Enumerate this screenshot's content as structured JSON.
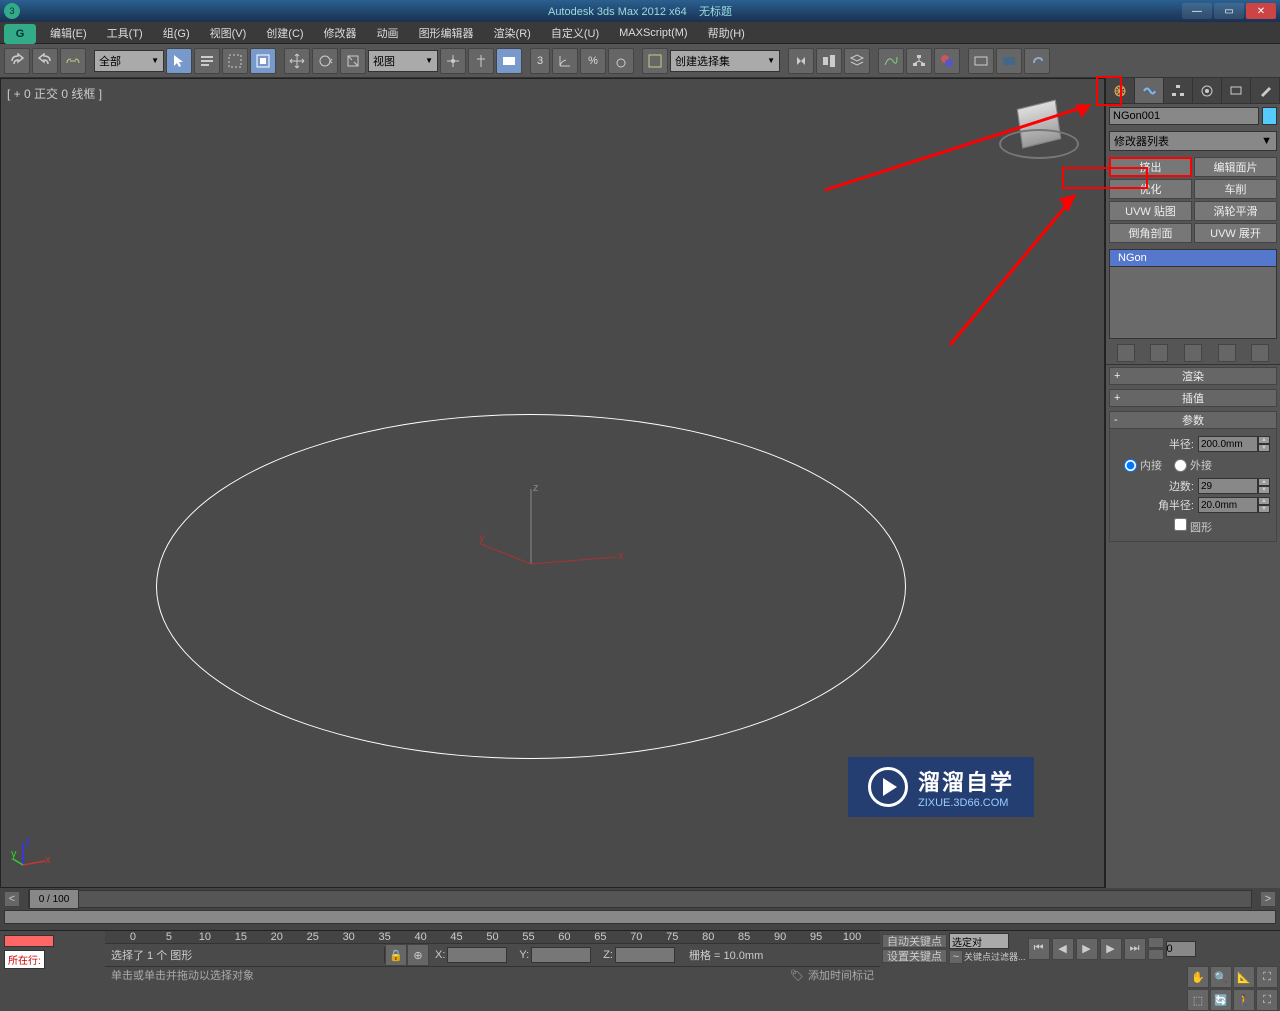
{
  "title": {
    "app": "Autodesk 3ds Max  2012 x64",
    "doc": "无标题"
  },
  "menu": [
    "编辑(E)",
    "工具(T)",
    "组(G)",
    "视图(V)",
    "创建(C)",
    "修改器",
    "动画",
    "图形编辑器",
    "渲染(R)",
    "自定义(U)",
    "MAXScript(M)",
    "帮助(H)"
  ],
  "toolbar": {
    "filter": "全部",
    "refcoord": "视图",
    "named_sel": "创建选择集"
  },
  "viewport": {
    "label": "[ + 0 正交 0 线框  ]"
  },
  "cmdpanel": {
    "obj_name": "NGon001",
    "modlist_label": "修改器列表",
    "buttons": {
      "extrude": "挤出",
      "edit_patch": "编辑面片",
      "optimize": "优化",
      "lathe": "车削",
      "uvw_map": "UVW 贴图",
      "turbosmooth": "涡轮平滑",
      "bevel_profile": "倒角剖面",
      "uvw_unwrap": "UVW 展开"
    },
    "stack_item": "NGon",
    "rollouts": {
      "render": "渲染",
      "interp": "插值",
      "params": "参数"
    },
    "params": {
      "radius_label": "半径:",
      "radius": "200.0mm",
      "inscribed": "内接",
      "circumscribed": "外接",
      "sides_label": "边数:",
      "sides": "29",
      "corner_radius_label": "角半径:",
      "corner_radius": "20.0mm",
      "circular": "圆形"
    }
  },
  "timeline": {
    "marker": "0 / 100",
    "ticks": [
      "0",
      "5",
      "10",
      "15",
      "20",
      "25",
      "30",
      "35",
      "40",
      "45",
      "50",
      "55",
      "60",
      "65",
      "70",
      "75",
      "80",
      "85",
      "90",
      "95",
      "100"
    ]
  },
  "status": {
    "nowrow_label": "所在行:",
    "selected": "选择了 1 个 图形",
    "prompt": "单击或单击并拖动以选择对象",
    "x_label": "X:",
    "y_label": "Y:",
    "z_label": "Z:",
    "grid": "栅格 = 10.0mm",
    "add_time_tag": "添加时间标记",
    "auto_key": "自动关键点",
    "set_key": "设置关键点",
    "sel_filter": "选定对",
    "key_filter": "关键点过滤器..."
  },
  "watermark": {
    "main": "溜溜自学",
    "sub": "ZIXUE.3D66.COM"
  }
}
